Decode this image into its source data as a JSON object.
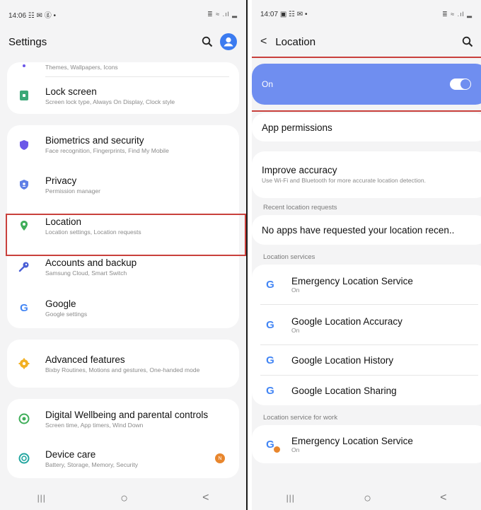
{
  "left": {
    "status": {
      "time": "14:06",
      "notif": "☷ ✉ ⓖ •",
      "right": "≣ ≈ .ıl ▂"
    },
    "title": "Settings",
    "partial_sub": "Themes, Wallpapers, Icons",
    "items": [
      {
        "title": "Lock screen",
        "sub": "Screen lock type, Always On Display, Clock style",
        "icon": "lock-icon",
        "color": "#3aa877"
      },
      {
        "title": "Biometrics and security",
        "sub": "Face recognition, Fingerprints, Find My Mobile",
        "icon": "shield-icon",
        "color": "#6b57e8"
      },
      {
        "title": "Privacy",
        "sub": "Permission manager",
        "icon": "privacy-shield-icon",
        "color": "#5f7fe6"
      },
      {
        "title": "Location",
        "sub": "Location settings, Location requests",
        "icon": "location-pin-icon",
        "color": "#3fae59"
      },
      {
        "title": "Accounts and backup",
        "sub": "Samsung Cloud, Smart Switch",
        "icon": "key-icon",
        "color": "#4a5fd6"
      },
      {
        "title": "Google",
        "sub": "Google settings",
        "icon": "google-icon",
        "color": "#4285F4"
      },
      {
        "title": "Advanced features",
        "sub": "Bixby Routines, Motions and gestures, One-handed mode",
        "icon": "gear-plus-icon",
        "color": "#f2b022"
      },
      {
        "title": "Digital Wellbeing and parental controls",
        "sub": "Screen time, App timers, Wind Down",
        "icon": "wellbeing-icon",
        "color": "#3fae59"
      },
      {
        "title": "Device care",
        "sub": "Battery, Storage, Memory, Security",
        "icon": "device-care-icon",
        "color": "#23a6a0",
        "badge": "N"
      }
    ],
    "nav": {
      "recent": "|||",
      "home": "○",
      "back": "<"
    }
  },
  "right": {
    "status": {
      "time": "14:07",
      "notif": "▣ ☷ ✉ •",
      "right": "≣ ≈ .ıl ▂"
    },
    "title": "Location",
    "toggle": {
      "label": "On",
      "state": "on"
    },
    "app_permissions": "App permissions",
    "improve": {
      "title": "Improve accuracy",
      "sub": "Use Wi-Fi and Bluetooth for more accurate location detection."
    },
    "recent_label": "Recent location requests",
    "recent_text": "No apps have requested your location recen..",
    "services_label": "Location services",
    "services": [
      {
        "title": "Emergency Location Service",
        "sub": "On"
      },
      {
        "title": "Google Location Accuracy",
        "sub": "On"
      },
      {
        "title": "Google Location History",
        "sub": ""
      },
      {
        "title": "Google Location Sharing",
        "sub": ""
      }
    ],
    "work_label": "Location service for work",
    "work_service": {
      "title": "Emergency Location Service",
      "sub": "On"
    },
    "nav": {
      "recent": "|||",
      "home": "○",
      "back": "<"
    }
  },
  "colors": {
    "toggle_bg": "#6f8ef0",
    "highlight": "#c9403c"
  }
}
